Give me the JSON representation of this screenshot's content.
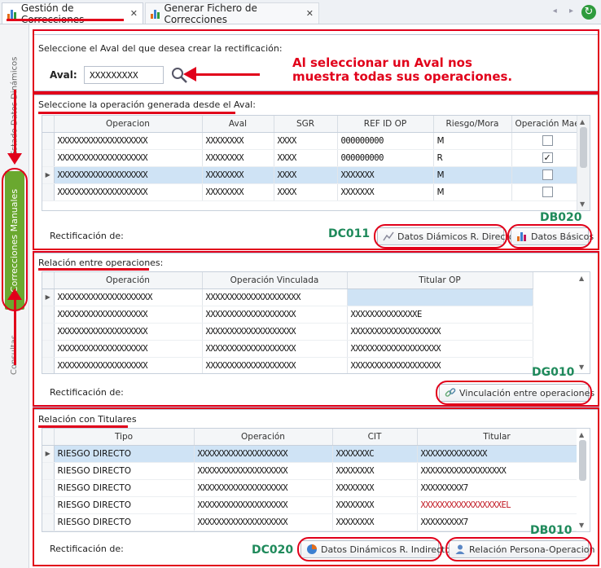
{
  "tabs": [
    {
      "label": "Gestión de Correcciones",
      "active": true
    },
    {
      "label": "Generar Fichero de Correcciones",
      "active": false
    }
  ],
  "left_nav": {
    "top_label": "Estado Datos Dinámicos",
    "main_label": "Correcciones Manuales",
    "bottom_label": "Consultas"
  },
  "aval_section": {
    "prompt": "Seleccione el Aval del que desea crear la rectificación:",
    "aval_label": "Aval:",
    "aval_value": "XXXXXXXXX",
    "annotation": "Al seleccionar un Aval nos muestra todas sus operaciones."
  },
  "operaciones_section": {
    "title": "Seleccione la operación generada desde el Aval:",
    "columns": [
      "Operacion",
      "Aval",
      "SGR",
      "REF ID OP",
      "Riesgo/Mora",
      "Operación Mae"
    ],
    "rows": [
      {
        "operacion": "XXXXXXXXXXXXXXXXXXX",
        "aval": "XXXXXXXX",
        "sgr": "XXXX",
        "ref": "000000000",
        "riesgo": "M",
        "checked": false
      },
      {
        "operacion": "XXXXXXXXXXXXXXXXXXX",
        "aval": "XXXXXXXX",
        "sgr": "XXXX",
        "ref": "000000000",
        "riesgo": "R",
        "checked": true
      },
      {
        "operacion": "XXXXXXXXXXXXXXXXXXX",
        "aval": "XXXXXXXX",
        "sgr": "XXXX",
        "ref": "XXXXXXX",
        "riesgo": "M",
        "checked": false
      },
      {
        "operacion": "XXXXXXXXXXXXXXXXXXX",
        "aval": "XXXXXXXX",
        "sgr": "XXXX",
        "ref": "XXXXXXX",
        "riesgo": "M",
        "checked": false
      }
    ],
    "selected_row": 2,
    "rect_label": "Rectificación de:",
    "btn_dinamicos": "Datos Diámicos R. Directo",
    "btn_basicos": "Datos Básicos",
    "code_dinamicos": "DC011",
    "code_basicos": "DB020"
  },
  "relacion_section": {
    "title": "Relación entre operaciones:",
    "columns": [
      "Operación",
      "Operación Vinculada",
      "Titular OP"
    ],
    "rows": [
      {
        "operacion": "XXXXXXXXXXXXXXXXXXXX",
        "vinculada": "XXXXXXXXXXXXXXXXXXXX",
        "titular": ""
      },
      {
        "operacion": "XXXXXXXXXXXXXXXXXXX",
        "vinculada": "XXXXXXXXXXXXXXXXXXX",
        "titular": "XXXXXXXXXXXXXXE"
      },
      {
        "operacion": "XXXXXXXXXXXXXXXXXXX",
        "vinculada": "XXXXXXXXXXXXXXXXXXX",
        "titular": "XXXXXXXXXXXXXXXXXXX"
      },
      {
        "operacion": "XXXXXXXXXXXXXXXXXXX",
        "vinculada": "XXXXXXXXXXXXXXXXXXX",
        "titular": "XXXXXXXXXXXXXXXXXXX"
      },
      {
        "operacion": "XXXXXXXXXXXXXXXXXXX",
        "vinculada": "XXXXXXXXXXXXXXXXXXX",
        "titular": "XXXXXXXXXXXXXXXXXXX"
      }
    ],
    "selected_row": 0,
    "rect_label": "Rectificación de:",
    "btn_vinculacion": "Vinculación entre operaciones",
    "code_vinculacion": "DG010"
  },
  "titulares_section": {
    "title": "Relación con Titulares",
    "columns": [
      "Tipo",
      "Operación",
      "CIT",
      "Titular"
    ],
    "rows": [
      {
        "tipo": "RIESGO DIRECTO",
        "operacion": "XXXXXXXXXXXXXXXXXXX",
        "cit": "XXXXXXXC",
        "titular": "XXXXXXXXXXXXXX"
      },
      {
        "tipo": "RIESGO DIRECTO",
        "operacion": "XXXXXXXXXXXXXXXXXXX",
        "cit": "XXXXXXXX",
        "titular": "XXXXXXXXXXXXXXXXXX"
      },
      {
        "tipo": "RIESGO DIRECTO",
        "operacion": "XXXXXXXXXXXXXXXXXXX",
        "cit": "XXXXXXXX",
        "titular": "XXXXXXXXX7"
      },
      {
        "tipo": "RIESGO DIRECTO",
        "operacion": "XXXXXXXXXXXXXXXXXXX",
        "cit": "XXXXXXXX",
        "titular": "XXXXXXXXXXXXXXXXXEL"
      },
      {
        "tipo": "RIESGO DIRECTO",
        "operacion": "XXXXXXXXXXXXXXXXXXX",
        "cit": "XXXXXXXX",
        "titular": "XXXXXXXXX7"
      }
    ],
    "selected_row": 0,
    "rect_label": "Rectificación de:",
    "btn_indirecto": "Datos Dinámicos R. Indirecto",
    "btn_relacion": "Relación Persona-Operacion",
    "code_indirecto": "DC020",
    "code_relacion": "DB010"
  },
  "colors": {
    "annotation_red": "#e1001a",
    "code_green": "#1f8a5b",
    "nav_green": "#6aa82f",
    "selection": "#cfe3f5"
  }
}
